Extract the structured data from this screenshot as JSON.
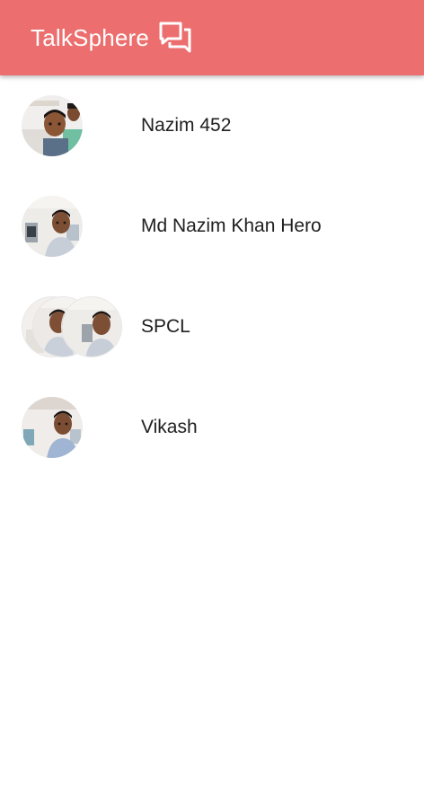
{
  "appbar": {
    "title": "TalkSphere",
    "icon": "forum-chat-icon",
    "background_color": "#ec6e6e"
  },
  "chats": [
    {
      "name": "Nazim 452",
      "avatar": "user-photo",
      "type": "direct"
    },
    {
      "name": "Md Nazim Khan Hero",
      "avatar": "user-photo",
      "type": "direct"
    },
    {
      "name": "SPCL",
      "avatar": "group-photo-stack",
      "type": "group"
    },
    {
      "name": "Vikash",
      "avatar": "user-photo",
      "type": "direct"
    }
  ]
}
